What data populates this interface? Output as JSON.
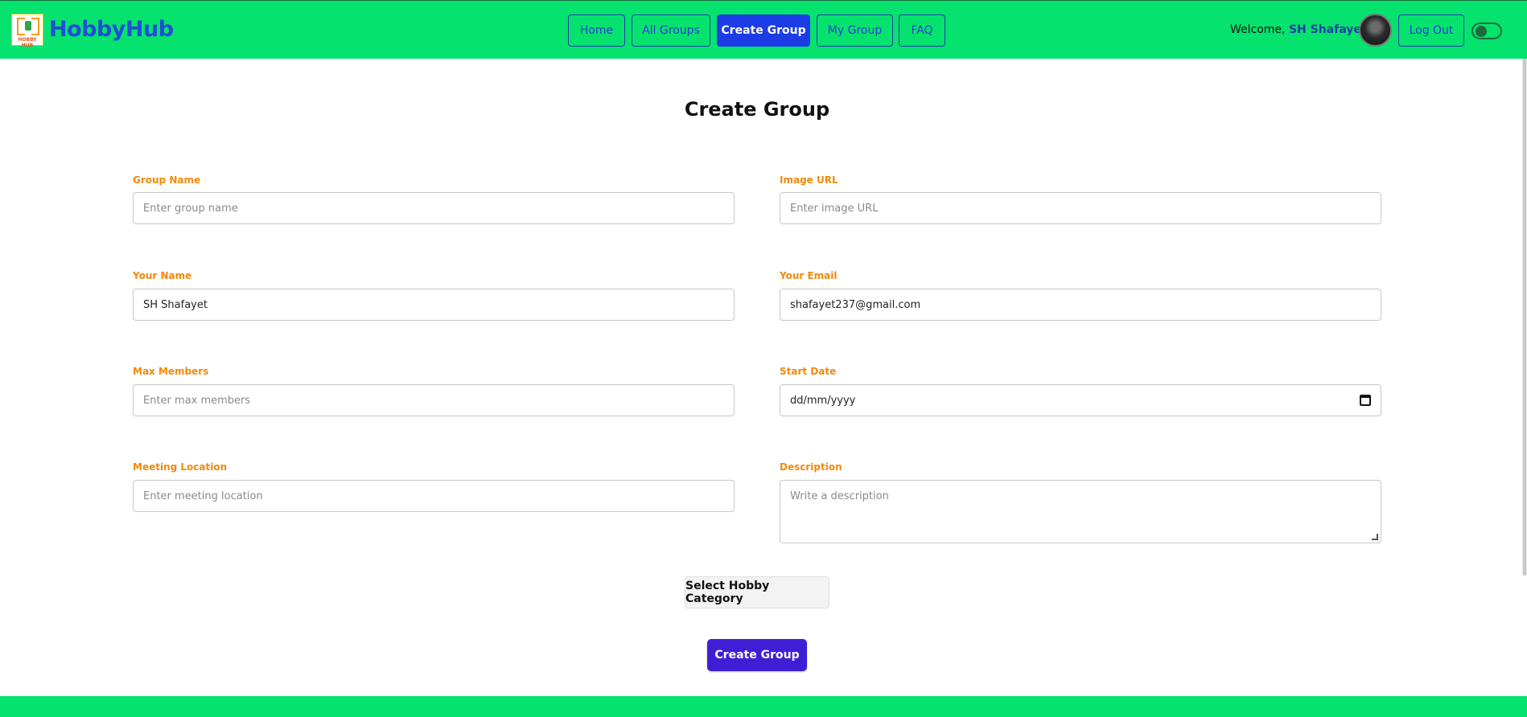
{
  "brand": {
    "name": "HobbyHub",
    "logo_text": "HOBBY HUB",
    "color": "#1f4fd6"
  },
  "nav": {
    "items": [
      {
        "label": "Home"
      },
      {
        "label": "All Groups"
      },
      {
        "label": "Create Group"
      },
      {
        "label": "My Group"
      },
      {
        "label": "FAQ"
      }
    ],
    "active": "Create Group"
  },
  "user": {
    "welcome_prefix": "Welcome, ",
    "name": "SH Shafayet",
    "logout_label": "Log Out"
  },
  "theme_toggle": {
    "icon": "toggle-switch-icon",
    "state": "off"
  },
  "page": {
    "title": "Create Group"
  },
  "form": {
    "group_name": {
      "label": "Group Name",
      "value": "",
      "placeholder": "Enter group name"
    },
    "image_url": {
      "label": "Image URL",
      "value": "",
      "placeholder": "Enter image URL"
    },
    "your_name": {
      "label": "Your Name",
      "value": "SH Shafayet"
    },
    "your_email": {
      "label": "Your Email",
      "value": "shafayet237@gmail.com"
    },
    "max_members": {
      "label": "Max Members",
      "value": "",
      "placeholder": "Enter max members"
    },
    "start_date": {
      "label": "Start Date",
      "value": "dd/mm/yyyy",
      "icon": "calendar-icon"
    },
    "meeting_location": {
      "label": "Meeting Location",
      "value": "",
      "placeholder": "Enter meeting location"
    },
    "description": {
      "label": "Description",
      "value": "",
      "placeholder": "Write a description"
    },
    "category_button": "Select Hobby Category",
    "submit_button": "Create Group"
  },
  "colors": {
    "navbar": "#05e26e",
    "label": "#f08a0c",
    "accent": "#3f1fd6",
    "nav_active": "#1c3de6"
  }
}
